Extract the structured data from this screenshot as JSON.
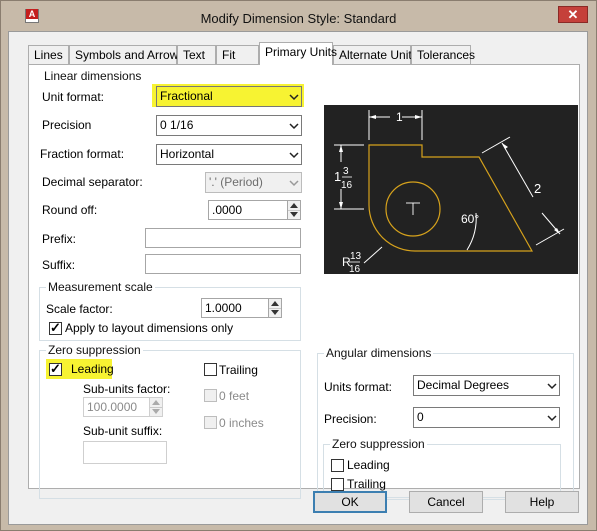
{
  "window": {
    "title": "Modify Dimension Style: Standard",
    "close_glyph": "✕",
    "app_icon_letter": "A"
  },
  "tabs": [
    {
      "label": "Lines"
    },
    {
      "label": "Symbols and Arrows"
    },
    {
      "label": "Text"
    },
    {
      "label": "Fit"
    },
    {
      "label": "Primary Units"
    },
    {
      "label": "Alternate Units"
    },
    {
      "label": "Tolerances"
    }
  ],
  "linear": {
    "legend": "Linear dimensions",
    "unit_format": {
      "label": "Unit format:",
      "value": "Fractional"
    },
    "precision": {
      "label": "Precision",
      "value": "0 1/16"
    },
    "fraction_format": {
      "label": "Fraction format:",
      "value": "Horizontal"
    },
    "decimal_separator": {
      "label": "Decimal separator:",
      "value": "'.' (Period)"
    },
    "round_off": {
      "label": "Round off:",
      "value": ".0000"
    },
    "prefix": {
      "label": "Prefix:",
      "value": ""
    },
    "suffix": {
      "label": "Suffix:",
      "value": ""
    }
  },
  "measurement": {
    "legend": "Measurement scale",
    "scale_factor": {
      "label": "Scale factor:",
      "value": "1.0000"
    },
    "apply_layout": {
      "label": "Apply to layout dimensions only",
      "checked": true
    }
  },
  "zero_linear": {
    "legend": "Zero suppression",
    "leading": {
      "label": "Leading",
      "checked": true
    },
    "trailing": {
      "label": "Trailing",
      "checked": false
    },
    "feet": {
      "label": "0 feet",
      "checked": false
    },
    "inches": {
      "label": "0 inches",
      "checked": false
    },
    "sub_units_factor": {
      "label": "Sub-units factor:",
      "value": "100.0000"
    },
    "sub_unit_suffix": {
      "label": "Sub-unit suffix:",
      "value": ""
    }
  },
  "angular": {
    "legend": "Angular dimensions",
    "units_format": {
      "label": "Units format:",
      "value": "Decimal Degrees"
    },
    "precision": {
      "label": "Precision:",
      "value": "0"
    },
    "zero": {
      "legend": "Zero suppression",
      "leading": {
        "label": "Leading",
        "checked": false
      },
      "trailing": {
        "label": "Trailing",
        "checked": false
      }
    }
  },
  "preview": {
    "dim_top": "1",
    "dim_left_whole": "1",
    "dim_left_num": "3",
    "dim_left_den": "16",
    "dim_right": "2",
    "dim_angle": "60°",
    "dim_radius_prefix": "R",
    "dim_radius_num": "13",
    "dim_radius_den": "16"
  },
  "buttons": {
    "ok": "OK",
    "cancel": "Cancel",
    "help": "Help"
  },
  "colors": {
    "highlight": "#f7f332",
    "preview_bg": "#222222",
    "preview_shape": "#d6a21c",
    "preview_dim": "#ffffff"
  }
}
